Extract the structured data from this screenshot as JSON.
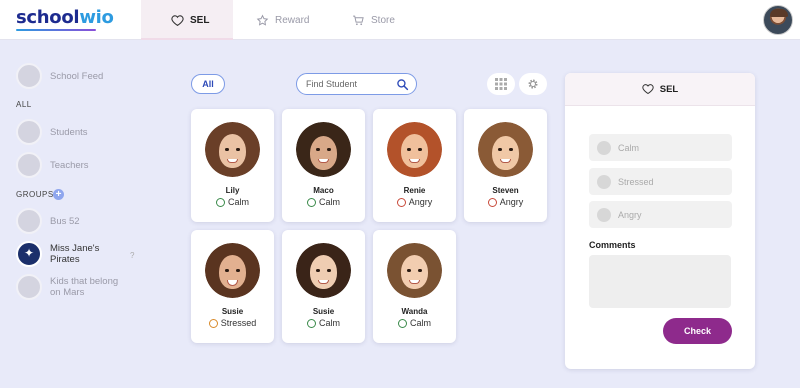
{
  "brand": {
    "logo_part1": "school",
    "logo_part2": "wio"
  },
  "topnav": {
    "tabs": [
      {
        "label": "SEL",
        "icon": "heart-icon",
        "active": true
      },
      {
        "label": "Reward",
        "icon": "star-icon",
        "active": false
      },
      {
        "label": "Store",
        "icon": "cart-icon",
        "active": false
      }
    ]
  },
  "sidebar": {
    "school_feed": "School Feed",
    "all_label": "ALL",
    "students": "Students",
    "teachers": "Teachers",
    "groups_label": "GROUPS",
    "groups": [
      {
        "label": "Bus 52"
      },
      {
        "label": "Miss Jane's Pirates",
        "active": true
      },
      {
        "label": "Kids that belong on Mars"
      }
    ],
    "help_mark": "?"
  },
  "filters": {
    "all_label": "All",
    "search_placeholder": "Find Student"
  },
  "students": [
    {
      "name": "Lily",
      "mood": "Calm",
      "mood_icon": "calm-face-icon"
    },
    {
      "name": "Maco",
      "mood": "Calm",
      "mood_icon": "calm-face-icon"
    },
    {
      "name": "Renie",
      "mood": "Angry",
      "mood_icon": "angry-face-icon"
    },
    {
      "name": "Steven",
      "mood": "Angry",
      "mood_icon": "angry-face-icon"
    },
    {
      "name": "Susie",
      "mood": "Stressed",
      "mood_icon": "stressed-face-icon"
    },
    {
      "name": "Susie",
      "mood": "Calm",
      "mood_icon": "calm-face-icon"
    },
    {
      "name": "Wanda",
      "mood": "Calm",
      "mood_icon": "calm-face-icon"
    }
  ],
  "panel": {
    "title": "SEL",
    "moods": [
      {
        "label": "Calm",
        "icon": "calm-face-icon"
      },
      {
        "label": "Stressed",
        "icon": "stressed-face-icon"
      },
      {
        "label": "Angry",
        "icon": "angry-face-icon"
      }
    ],
    "comments_label": "Comments",
    "comments_value": "",
    "check_label": "Check"
  },
  "colors": {
    "background": "#e8eaf9",
    "accent": "#8e2a8c",
    "brand_dark": "#1d2b8f",
    "brand_light": "#2d9be0",
    "calm": "#3a8a4a",
    "angry": "#c84a3a",
    "stressed": "#d88a2a"
  }
}
